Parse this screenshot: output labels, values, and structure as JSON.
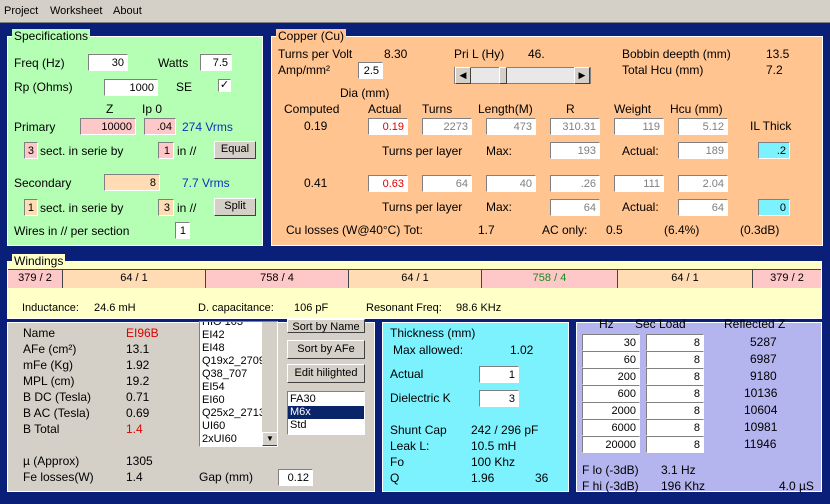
{
  "menu": {
    "project": "Project",
    "worksheet": "Worksheet",
    "about": "About"
  },
  "specs": {
    "title": "Specifications",
    "freq_label": "Freq (Hz)",
    "freq": "30",
    "watts_label": "Watts",
    "watts": "7.5",
    "rp_label": "Rp (Ohms)",
    "rp": "1000",
    "se_label": "SE",
    "se_check": "✓",
    "z_hdr": "Z",
    "ip_hdr": "Ip 0",
    "primary_label": "Primary",
    "primary_z": "10000",
    "primary_ip": ".04",
    "primary_vrms": "274 Vrms",
    "p_sect": "3",
    "sect_label": "sect. in serie by",
    "p_par": "1",
    "par_label": "in //",
    "equal_btn": "Equal",
    "secondary_label": "Secondary",
    "secondary_z": "8",
    "secondary_vrms": "7.7 Vrms",
    "s_sect": "1",
    "s_par": "3",
    "split_btn": "Split",
    "wires_label": "Wires in // per section",
    "wires": "1"
  },
  "copper": {
    "title": "Copper (Cu)",
    "tpv_label": "Turns per Volt",
    "tpv": "8.30",
    "pril_label": "Pri L (Hy)",
    "pril": "46.",
    "bobbin_label": "Bobbin deepth (mm)",
    "bobbin": "13.5",
    "amp_label": "Amp/mm²",
    "amp": "2.5",
    "hcu_label": "Total Hcu (mm)",
    "hcu": "7.2",
    "dia_label": "Dia (mm)",
    "h_computed": "Computed",
    "h_actual": "Actual",
    "h_turns": "Turns",
    "h_length": "Length(M)",
    "h_r": "R",
    "h_weight": "Weight",
    "h_hcu": "Hcu (mm)",
    "h_il": "IL Thick",
    "pri_comp": "0.19",
    "pri_act": "0.19",
    "pri_turns": "2273",
    "pri_len": "473",
    "pri_r": "310.31",
    "pri_wt": "119",
    "pri_hcu": "5.12",
    "pri_il": ".2",
    "tpl_label": "Turns per layer",
    "max_label": "Max:",
    "actual_label": "Actual:",
    "pri_max": "193",
    "pri_actual": "189",
    "sec_comp": "0.41",
    "sec_act": "0.63",
    "sec_turns": "64",
    "sec_len": "40",
    "sec_r": ".26",
    "sec_wt": "111",
    "sec_hcu": "2.04",
    "sec_il": "0",
    "sec_max": "64",
    "sec_actual": "64",
    "culoss_label": "Cu losses (W@40°C) Tot:",
    "culoss": "1.7",
    "aconly_label": "AC only:",
    "aconly": "0.5",
    "pct": "(6.4%)",
    "db": "(0.3dB)"
  },
  "windings": {
    "title": "Windings",
    "cells": [
      "379 / 2",
      "64 / 1",
      "758 / 4",
      "64 / 1",
      "758 / 4",
      "64 / 1",
      "379 / 2"
    ],
    "ind_label": "Inductance:",
    "ind": "24.6 mH",
    "dcap_label": "D. capacitance:",
    "dcap": "106 pF",
    "res_label": "Resonant Freq:",
    "res": "98.6 KHz"
  },
  "core": {
    "name_label": "Name",
    "name": "EI96B",
    "afe_label": "AFe (cm²)",
    "afe": "13.1",
    "mfe_label": "mFe (Kg)",
    "mfe": "1.92",
    "mpl_label": "MPL (cm)",
    "mpl": "19.2",
    "bdc_label": "B DC (Tesla)",
    "bdc": "0.71",
    "bac_label": "B AC (Tesla)",
    "bac": "0.69",
    "btot_label": "B Total",
    "btot": "1.4",
    "mu_label": "µ (Approx)",
    "mu": "1305",
    "fel_label": "Fe losses(W)",
    "fel": "1.4",
    "core_list": [
      "HIO 103",
      "EI42",
      "EI48",
      "Q19x2_2709",
      "Q38_707",
      "EI54",
      "EI60",
      "Q25x2_2713",
      "UI60",
      "2xUI60"
    ],
    "sort_name_btn": "Sort by Name",
    "sort_afe_btn": "Sort by AFe",
    "edit_btn": "Edit hilighted",
    "mat_list": [
      "FA30",
      "M6x",
      "Std"
    ],
    "gap_label": "Gap (mm)",
    "gap": "0.12"
  },
  "insulation": {
    "thick_label": "Thickness (mm)",
    "maxallowed_label": "Max allowed:",
    "maxallowed": "1.02",
    "actual_label": "Actual",
    "actual": "1",
    "dk_label": "Dielectric K",
    "dk": "3",
    "shunt_label": "Shunt Cap",
    "shunt": "242 / 296 pF",
    "leak_label": "Leak L:",
    "leak": "10.5 mH",
    "fo_label": "Fo",
    "fo": "100 Khz",
    "q_label": "Q",
    "q": "1.96",
    "q2": "36"
  },
  "response": {
    "hz_hdr": "Hz",
    "load_hdr": "Sec Load",
    "refl_hdr": "Reflected Z",
    "rows": [
      {
        "hz": "30",
        "load": "8",
        "z": "5287"
      },
      {
        "hz": "60",
        "load": "8",
        "z": "6987"
      },
      {
        "hz": "200",
        "load": "8",
        "z": "9180"
      },
      {
        "hz": "600",
        "load": "8",
        "z": "10136"
      },
      {
        "hz": "2000",
        "load": "8",
        "z": "10604"
      },
      {
        "hz": "6000",
        "load": "8",
        "z": "10981"
      },
      {
        "hz": "20000",
        "load": "8",
        "z": "11946"
      }
    ],
    "flo_label": "F lo (-3dB)",
    "flo": "3.1 Hz",
    "fhi_label": "F hi (-3dB)",
    "fhi": "196 Khz",
    "rise": "4.0 µS"
  }
}
